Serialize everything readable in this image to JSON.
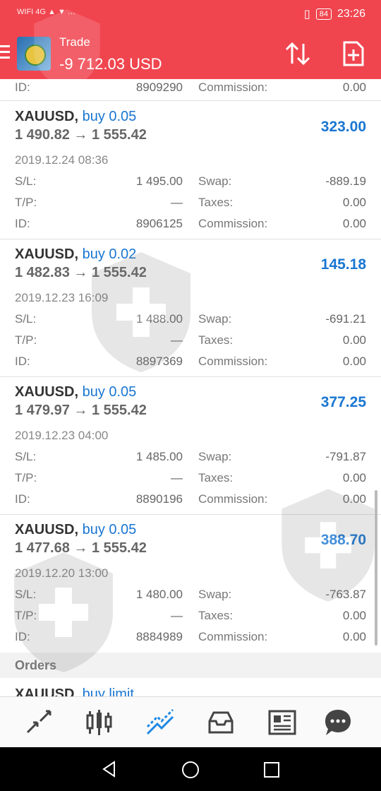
{
  "status_bar": {
    "left_text": "WIFI 4G ▲ ▼ …",
    "battery": "84",
    "time": "23:26"
  },
  "app_bar": {
    "title": "Trade",
    "balance": "-9 712.03 USD"
  },
  "top_partial_row": {
    "id_label": "ID:",
    "id": "8909290",
    "commission_label": "Commission:",
    "commission": "0.00"
  },
  "positions": [
    {
      "symbol": "XAUUSD,",
      "type": "buy 0.05",
      "open": "1 490.82",
      "close": "1 555.42",
      "arrow": "→",
      "profit": "323.00",
      "date": "2019.12.24 08:36",
      "sl": "1 495.00",
      "tp": "—",
      "id": "8906125",
      "swap": "-889.19",
      "taxes": "0.00",
      "commission": "0.00"
    },
    {
      "symbol": "XAUUSD,",
      "type": "buy 0.02",
      "open": "1 482.83",
      "close": "1 555.42",
      "arrow": "→",
      "profit": "145.18",
      "date": "2019.12.23 16:09",
      "sl": "1 488.00",
      "tp": "—",
      "id": "8897369",
      "swap": "-691.21",
      "taxes": "0.00",
      "commission": "0.00"
    },
    {
      "symbol": "XAUUSD,",
      "type": "buy 0.05",
      "open": "1 479.97",
      "close": "1 555.42",
      "arrow": "→",
      "profit": "377.25",
      "date": "2019.12.23 04:00",
      "sl": "1 485.00",
      "tp": "—",
      "id": "8890196",
      "swap": "-791.87",
      "taxes": "0.00",
      "commission": "0.00"
    },
    {
      "symbol": "XAUUSD,",
      "type": "buy 0.05",
      "open": "1 477.68",
      "close": "1 555.42",
      "arrow": "→",
      "profit": "388.70",
      "date": "2019.12.20 13:00",
      "sl": "1 480.00",
      "tp": "—",
      "id": "8884989",
      "swap": "-763.87",
      "taxes": "0.00",
      "commission": "0.00"
    }
  ],
  "labels": {
    "sl": "S/L:",
    "tp": "T/P:",
    "id": "ID:",
    "swap": "Swap:",
    "taxes": "Taxes:",
    "commission": "Commission:"
  },
  "orders_section": {
    "title": "Orders",
    "partial_symbol": "XAUUSD,",
    "partial_type": "buy limit"
  },
  "bottom_nav": [
    "quotes-icon",
    "chart-icon",
    "trade-icon",
    "mailbox-icon",
    "news-icon",
    "chat-icon"
  ],
  "colors": {
    "header": "#f0454f",
    "accent": "#1976d2"
  }
}
